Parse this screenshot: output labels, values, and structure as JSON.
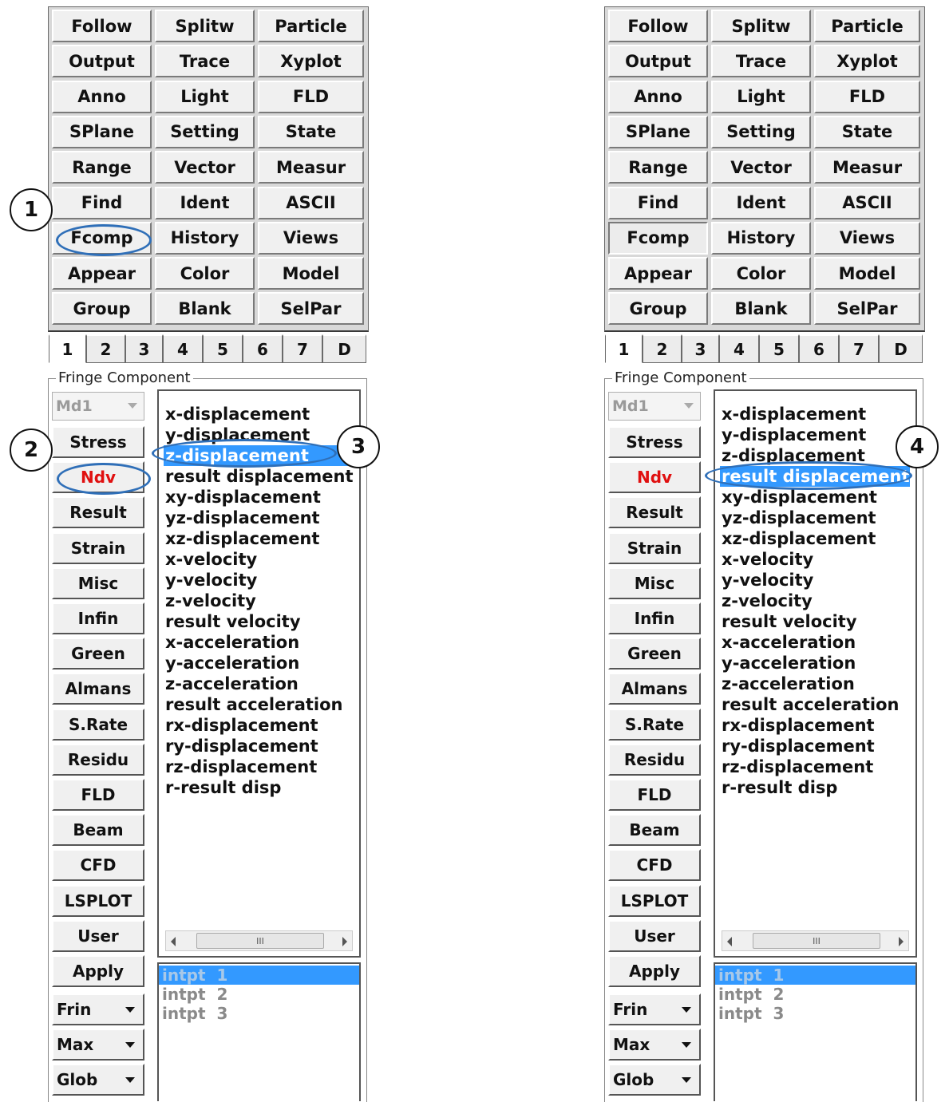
{
  "menu_rows": [
    [
      "Follow",
      "Splitw",
      "Particle"
    ],
    [
      "Output",
      "Trace",
      "Xyplot"
    ],
    [
      "Anno",
      "Light",
      "FLD"
    ],
    [
      "SPlane",
      "Setting",
      "State"
    ],
    [
      "Range",
      "Vector",
      "Measur"
    ],
    [
      "Find",
      "Ident",
      "ASCII"
    ],
    [
      "Fcomp",
      "History",
      "Views"
    ],
    [
      "Appear",
      "Color",
      "Model"
    ],
    [
      "Group",
      "Blank",
      "SelPar"
    ]
  ],
  "tabs": [
    "1",
    "2",
    "3",
    "4",
    "5",
    "6",
    "7",
    "D"
  ],
  "fringe": {
    "legend": "Fringe Component",
    "model_dropdown": "Md1",
    "side_buttons": [
      "Stress",
      "Ndv",
      "Result",
      "Strain",
      "Misc",
      "Infin",
      "Green",
      "Almans",
      "S.Rate",
      "Residu",
      "FLD",
      "Beam",
      "CFD",
      "LSPLOT",
      "User",
      "Apply"
    ],
    "active_button": "Ndv",
    "dropdowns": [
      "Frin",
      "Max",
      "Glob"
    ],
    "components": [
      "x-displacement",
      "y-displacement",
      "z-displacement",
      "result displacement",
      "xy-displacement",
      "yz-displacement",
      "xz-displacement",
      "x-velocity",
      "y-velocity",
      "z-velocity",
      "result velocity",
      "x-acceleration",
      "y-acceleration",
      "z-acceleration",
      "result acceleration",
      "rx-displacement",
      "ry-displacement",
      "rz-displacement",
      "r-result disp"
    ],
    "intpts": [
      "intpt  1",
      "intpt  2",
      "intpt  3"
    ],
    "scroll_thumb_label": "III"
  },
  "panels": {
    "left": {
      "selected_component": "z-displacement"
    },
    "right": {
      "selected_component": "result displacement"
    }
  },
  "callouts": [
    "1",
    "2",
    "3",
    "4"
  ],
  "colors": {
    "highlight": "#3399ff",
    "callout_ellipse": "#2f6fb8",
    "active_text": "#e01010"
  }
}
